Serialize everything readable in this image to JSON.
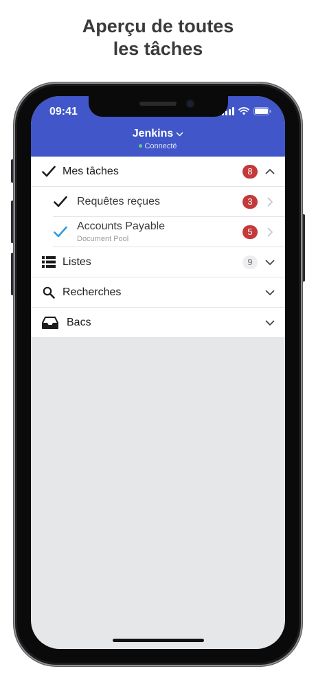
{
  "page": {
    "title_line1": "Aperçu de toutes",
    "title_line2": "les tâches"
  },
  "status_bar": {
    "time": "09:41",
    "icons": [
      "signal-icon",
      "wifi-icon",
      "battery-icon"
    ]
  },
  "header": {
    "title": "Jenkins",
    "status": "Connecté",
    "accent_color": "#4056c9",
    "status_dot_color": "#5cd18b"
  },
  "menu": {
    "my_tasks": {
      "label": "Mes tâches",
      "count": "8",
      "expanded": true
    },
    "received_requests": {
      "label": "Requêtes reçues",
      "count": "3"
    },
    "accounts_payable": {
      "label": "Accounts Payable",
      "caption": "Document Pool",
      "count": "5"
    },
    "lists": {
      "label": "Listes",
      "count": "9"
    },
    "searches": {
      "label": "Recherches"
    },
    "bins": {
      "label": "Bacs"
    }
  },
  "colors": {
    "badge_red": "#c43a3a",
    "check_blue": "#2a9be0"
  }
}
